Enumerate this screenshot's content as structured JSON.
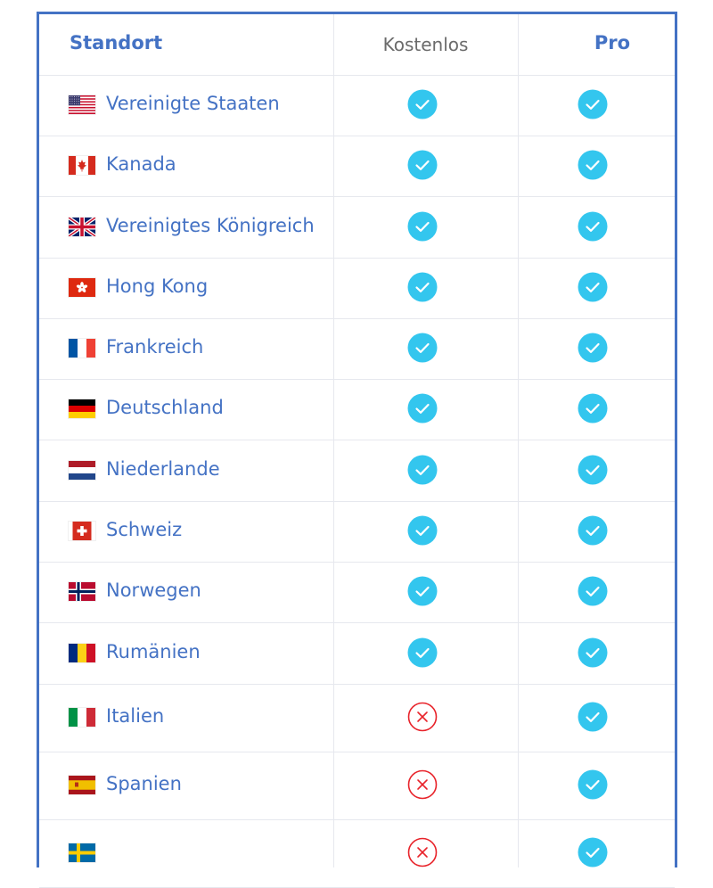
{
  "table": {
    "headers": {
      "location": "Standort",
      "free": "Kostenlos",
      "pro": "Pro"
    },
    "rows": [
      {
        "country": "Vereinigte Staaten",
        "flag": "us",
        "free": true,
        "pro": true
      },
      {
        "country": "Kanada",
        "flag": "ca",
        "free": true,
        "pro": true
      },
      {
        "country": "Vereinigtes Königreich",
        "flag": "gb",
        "free": true,
        "pro": true
      },
      {
        "country": "Hong Kong",
        "flag": "hk",
        "free": true,
        "pro": true
      },
      {
        "country": "Frankreich",
        "flag": "fr",
        "free": true,
        "pro": true
      },
      {
        "country": "Deutschland",
        "flag": "de",
        "free": true,
        "pro": true
      },
      {
        "country": "Niederlande",
        "flag": "nl",
        "free": true,
        "pro": true
      },
      {
        "country": "Schweiz",
        "flag": "ch",
        "free": true,
        "pro": true
      },
      {
        "country": "Norwegen",
        "flag": "no",
        "free": true,
        "pro": true
      },
      {
        "country": "Rumänien",
        "flag": "ro",
        "free": true,
        "pro": true
      },
      {
        "country": "Italien",
        "flag": "it",
        "free": false,
        "pro": true
      },
      {
        "country": "Spanien",
        "flag": "es",
        "free": false,
        "pro": true
      },
      {
        "country": "",
        "flag": "se",
        "free": false,
        "pro": true
      }
    ]
  },
  "icons": {
    "available": "check-circle-icon",
    "unavailable": "x-circle-icon"
  },
  "colors": {
    "accent": "#4472c4",
    "check": "#33c6ee",
    "cross": "#e8242b",
    "header_muted": "#6b6b6b"
  }
}
